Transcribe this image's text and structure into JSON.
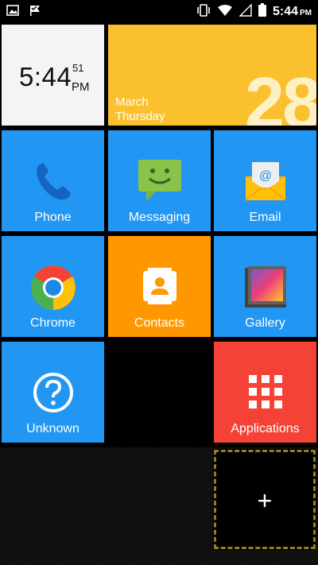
{
  "status_bar": {
    "time": "5:44",
    "ampm": "PM",
    "icons": [
      "image-icon",
      "check-flag-icon",
      "vibrate-icon",
      "wifi-icon",
      "signal-icon",
      "battery-icon"
    ]
  },
  "clock": {
    "time": "5:44",
    "seconds": "51",
    "ampm": "PM"
  },
  "date": {
    "month": "March",
    "weekday": "Thursday",
    "day": "28"
  },
  "tiles": [
    {
      "label": "Phone",
      "icon": "phone-icon"
    },
    {
      "label": "Messaging",
      "icon": "messaging-icon"
    },
    {
      "label": "Email",
      "icon": "email-icon"
    },
    {
      "label": "Chrome",
      "icon": "chrome-icon"
    },
    {
      "label": "Contacts",
      "icon": "contacts-icon"
    },
    {
      "label": "Gallery",
      "icon": "gallery-icon"
    },
    {
      "label": "Unknown",
      "icon": "question-icon"
    },
    {
      "label": "Applications",
      "icon": "app-grid-icon"
    }
  ],
  "add_tile": {
    "label": "+"
  },
  "colors": {
    "blue": "#2196f3",
    "yellow": "#fbc02d",
    "orange": "#ff9800",
    "red": "#f44336",
    "clock_bg": "#f4f4f4"
  }
}
